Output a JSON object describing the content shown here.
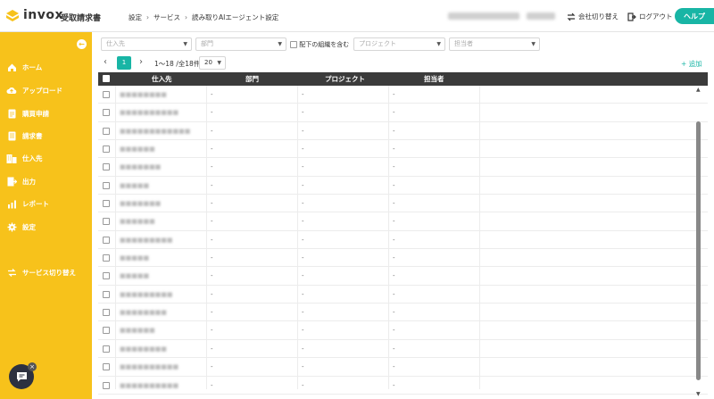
{
  "app": {
    "logo_text": "invox",
    "product": "受取請求書",
    "help_label": "ヘルプ",
    "switch_company_label": "会社切り替え",
    "logout_label": "ログアウト"
  },
  "breadcrumb": [
    "設定",
    "サービス",
    "読み取りAIエージェント設定"
  ],
  "sidebar": {
    "collapse_icon": "arrow-left-icon",
    "items": [
      {
        "label": "ホーム",
        "icon": "home-icon"
      },
      {
        "label": "アップロード",
        "icon": "cloud-upload-icon"
      },
      {
        "label": "購買申請",
        "icon": "document-icon"
      },
      {
        "label": "請求書",
        "icon": "invoice-icon"
      },
      {
        "label": "仕入先",
        "icon": "building-icon"
      },
      {
        "label": "出力",
        "icon": "export-icon"
      },
      {
        "label": "レポート",
        "icon": "chart-icon"
      },
      {
        "label": "設定",
        "icon": "gear-icon"
      }
    ],
    "service_switch_label": "サービス切り替え"
  },
  "filters": {
    "supplier_placeholder": "仕入先",
    "department_placeholder": "部門",
    "include_sub_label": "配下の組織を含む",
    "project_placeholder": "プロジェクト",
    "assignee_placeholder": "担当者"
  },
  "pager": {
    "prev": "‹",
    "current_page": "1",
    "next": "›",
    "range_text": "1〜18 /全18件",
    "per_page": "20"
  },
  "add_label": "追加",
  "table": {
    "columns": [
      "仕入先",
      "部門",
      "プロジェクト",
      "担当者"
    ],
    "rows": [
      {
        "name": "■■■■■■■■",
        "dept": "-",
        "project": "-",
        "assignee": "-"
      },
      {
        "name": "■■■■■■■■■■",
        "dept": "-",
        "project": "-",
        "assignee": "-"
      },
      {
        "name": "■■■■■■■■■■■■",
        "dept": "-",
        "project": "-",
        "assignee": "-"
      },
      {
        "name": "■■■■■■",
        "dept": "-",
        "project": "-",
        "assignee": "-"
      },
      {
        "name": "■■■■■■■",
        "dept": "-",
        "project": "-",
        "assignee": "-"
      },
      {
        "name": "■■■■■",
        "dept": "-",
        "project": "-",
        "assignee": "-"
      },
      {
        "name": "■■■■■■■",
        "dept": "-",
        "project": "-",
        "assignee": "-"
      },
      {
        "name": "■■■■■■",
        "dept": "-",
        "project": "-",
        "assignee": "-"
      },
      {
        "name": "■■■■■■■■■",
        "dept": "-",
        "project": "-",
        "assignee": "-"
      },
      {
        "name": "■■■■■",
        "dept": "-",
        "project": "-",
        "assignee": "-"
      },
      {
        "name": "■■■■■",
        "dept": "-",
        "project": "-",
        "assignee": "-"
      },
      {
        "name": "■■■■■■■■■",
        "dept": "-",
        "project": "-",
        "assignee": "-"
      },
      {
        "name": "■■■■■■■■",
        "dept": "-",
        "project": "-",
        "assignee": "-"
      },
      {
        "name": "■■■■■■",
        "dept": "-",
        "project": "-",
        "assignee": "-"
      },
      {
        "name": "■■■■■■■■",
        "dept": "-",
        "project": "-",
        "assignee": "-"
      },
      {
        "name": "■■■■■■■■■■",
        "dept": "-",
        "project": "-",
        "assignee": "-"
      },
      {
        "name": "■■■■■■■■■■",
        "dept": "-",
        "project": "-",
        "assignee": "-"
      }
    ]
  },
  "colors": {
    "sidebar": "#f7c21b",
    "accent": "#18b5a5",
    "table_header": "#3b3b3b"
  }
}
